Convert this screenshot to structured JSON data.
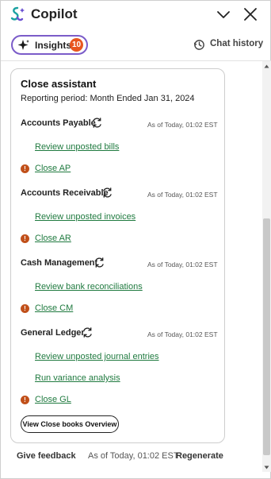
{
  "header": {
    "title": "Copilot",
    "icons": {
      "logo": "copilot-logo-icon",
      "collapse": "chevron-down-icon",
      "close": "close-icon"
    }
  },
  "tabs": {
    "insights_label": "Insights",
    "insights_count": "10",
    "chat_history_label": "Chat history"
  },
  "card": {
    "title": "Close assistant",
    "reporting_period": "Reporting period: Month Ended Jan 31, 2024",
    "sections": [
      {
        "heading": "Accounts Payable",
        "as_of": "As of Today, 01:02 EST",
        "links": [
          "Review unposted bills"
        ],
        "close_label": "Close AP"
      },
      {
        "heading": "Accounts Receivable",
        "as_of": "As of Today, 01:02 EST",
        "links": [
          "Review unposted invoices"
        ],
        "close_label": "Close AR"
      },
      {
        "heading": "Cash Management",
        "as_of": "As of Today, 01:02 EST",
        "links": [
          "Review bank reconciliations"
        ],
        "close_label": "Close CM"
      },
      {
        "heading": "General Ledger",
        "as_of": "As of Today, 01:02 EST",
        "links": [
          "Review unposted journal entries",
          "Run variance analysis"
        ],
        "close_label": "Close GL"
      }
    ],
    "warning_glyph": "!",
    "overview_button": "View Close books Overview"
  },
  "footer": {
    "feedback": "Give feedback",
    "as_of": "As of Today, 01:02 EST",
    "regenerate": "Regenerate"
  },
  "colors": {
    "accent_link": "#1f7a3f",
    "badge": "#e8561f",
    "warning": "#c1501a",
    "pill_border": "#7b5cc9"
  }
}
